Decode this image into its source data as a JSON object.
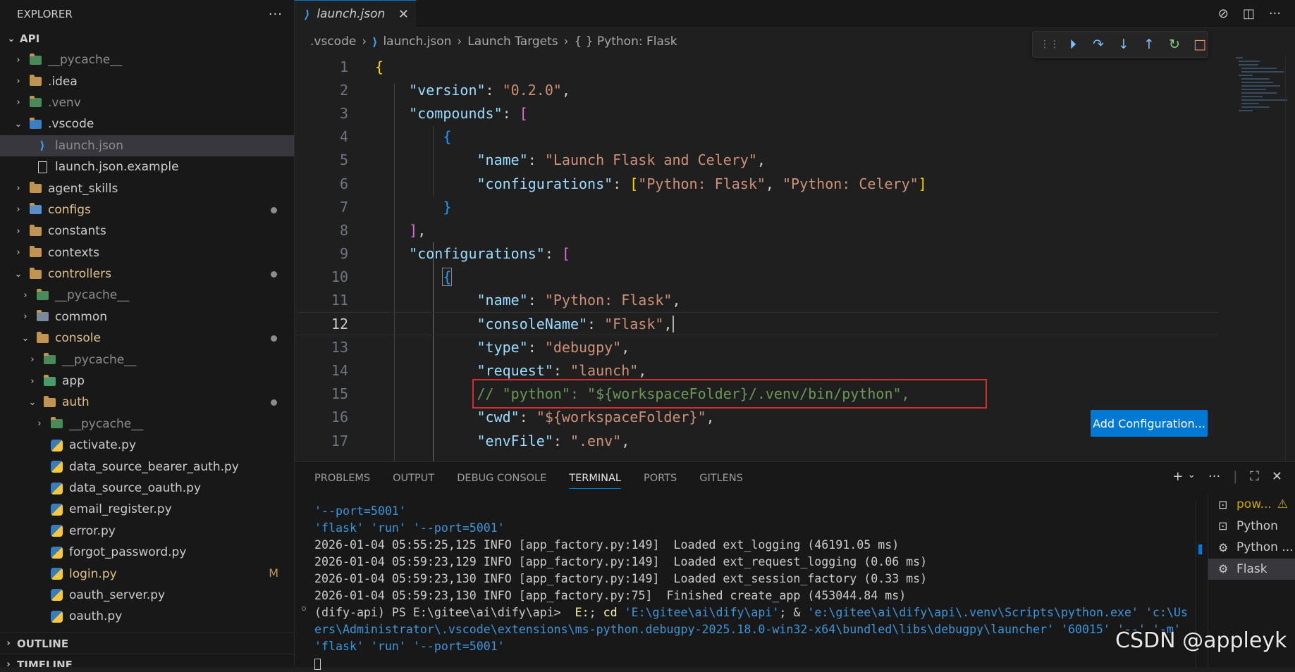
{
  "sidebar": {
    "title": "EXPLORER",
    "more": "···",
    "root": "API",
    "items": [
      {
        "label": "__pycache__",
        "depth": 0,
        "chev": "›",
        "icon": "python-folder-icon",
        "tone": "dim"
      },
      {
        "label": ".idea",
        "depth": 0,
        "chev": "›",
        "icon": "idea-folder-icon",
        "tone": "normal"
      },
      {
        "label": ".venv",
        "depth": 0,
        "chev": "›",
        "icon": "python-folder-icon",
        "tone": "dim"
      },
      {
        "label": ".vscode",
        "depth": 0,
        "chev": "⌄",
        "icon": "vscode-folder-icon",
        "tone": "normal"
      },
      {
        "label": "launch.json",
        "depth": 1,
        "chev": "",
        "icon": "vscode-file-icon",
        "tone": "dim",
        "selected": true
      },
      {
        "label": "launch.json.example",
        "depth": 1,
        "chev": "",
        "icon": "file-icon",
        "tone": "normal"
      },
      {
        "label": "agent_skills",
        "depth": 0,
        "chev": "›",
        "icon": "folder-icon",
        "tone": "normal"
      },
      {
        "label": "configs",
        "depth": 0,
        "chev": "›",
        "icon": "config-folder-icon",
        "tone": "yellow",
        "dot": true
      },
      {
        "label": "constants",
        "depth": 0,
        "chev": "›",
        "icon": "folder-icon",
        "tone": "normal"
      },
      {
        "label": "contexts",
        "depth": 0,
        "chev": "›",
        "icon": "folder-icon",
        "tone": "normal"
      },
      {
        "label": "controllers",
        "depth": 0,
        "chev": "⌄",
        "icon": "controllers-folder-icon",
        "tone": "yellow",
        "dot": true
      },
      {
        "label": "__pycache__",
        "depth": 1,
        "chev": "›",
        "icon": "python-folder-icon",
        "tone": "dim"
      },
      {
        "label": "common",
        "depth": 1,
        "chev": "›",
        "icon": "common-folder-icon",
        "tone": "normal"
      },
      {
        "label": "console",
        "depth": 1,
        "chev": "⌄",
        "icon": "console-folder-icon",
        "tone": "yellow",
        "dot": true
      },
      {
        "label": "__pycache__",
        "depth": 2,
        "chev": "›",
        "icon": "python-folder-icon",
        "tone": "dim"
      },
      {
        "label": "app",
        "depth": 2,
        "chev": "›",
        "icon": "app-folder-icon",
        "tone": "normal"
      },
      {
        "label": "auth",
        "depth": 2,
        "chev": "⌄",
        "icon": "folder-icon",
        "tone": "yellow",
        "dot": true
      },
      {
        "label": "__pycache__",
        "depth": 3,
        "chev": "›",
        "icon": "python-folder-icon",
        "tone": "dim"
      },
      {
        "label": "activate.py",
        "depth": 3,
        "chev": "",
        "icon": "python-file-icon",
        "tone": "normal"
      },
      {
        "label": "data_source_bearer_auth.py",
        "depth": 3,
        "chev": "",
        "icon": "python-file-icon",
        "tone": "normal"
      },
      {
        "label": "data_source_oauth.py",
        "depth": 3,
        "chev": "",
        "icon": "python-file-icon",
        "tone": "normal"
      },
      {
        "label": "email_register.py",
        "depth": 3,
        "chev": "",
        "icon": "python-file-icon",
        "tone": "normal"
      },
      {
        "label": "error.py",
        "depth": 3,
        "chev": "",
        "icon": "python-file-icon",
        "tone": "normal"
      },
      {
        "label": "forgot_password.py",
        "depth": 3,
        "chev": "",
        "icon": "python-file-icon",
        "tone": "normal"
      },
      {
        "label": "login.py",
        "depth": 3,
        "chev": "",
        "icon": "python-file-icon",
        "tone": "yellow",
        "mod": "M"
      },
      {
        "label": "oauth_server.py",
        "depth": 3,
        "chev": "",
        "icon": "python-file-icon",
        "tone": "normal"
      },
      {
        "label": "oauth.py",
        "depth": 3,
        "chev": "",
        "icon": "python-file-icon",
        "tone": "normal"
      }
    ],
    "outline": "OUTLINE",
    "timeline": "TIMELINE"
  },
  "editor": {
    "tab": "launch.json",
    "tab_close": "✕",
    "breadcrumb": [
      ".vscode",
      "launch.json",
      "Launch Targets",
      "{ } Python: Flask"
    ],
    "add_config": "Add Configuration...",
    "line_numbers": [
      "1",
      "2",
      "3",
      "4",
      "5",
      "6",
      "7",
      "8",
      "9",
      "10",
      "11",
      "12",
      "13",
      "14",
      "15",
      "16",
      "17"
    ],
    "current_line": "12"
  },
  "panel": {
    "tabs": [
      "PROBLEMS",
      "OUTPUT",
      "DEBUG CONSOLE",
      "TERMINAL",
      "PORTS",
      "GITLENS"
    ],
    "active_tab": "TERMINAL",
    "terminals": [
      {
        "label": "pow...",
        "icon": "terminal-icon",
        "warn": true
      },
      {
        "label": "Python",
        "icon": "terminal-icon"
      },
      {
        "label": "Python ...",
        "icon": "debug-gear-icon"
      },
      {
        "label": "Flask",
        "icon": "debug-gear-icon",
        "active": true
      }
    ]
  },
  "watermark": "CSDN @appleyk"
}
